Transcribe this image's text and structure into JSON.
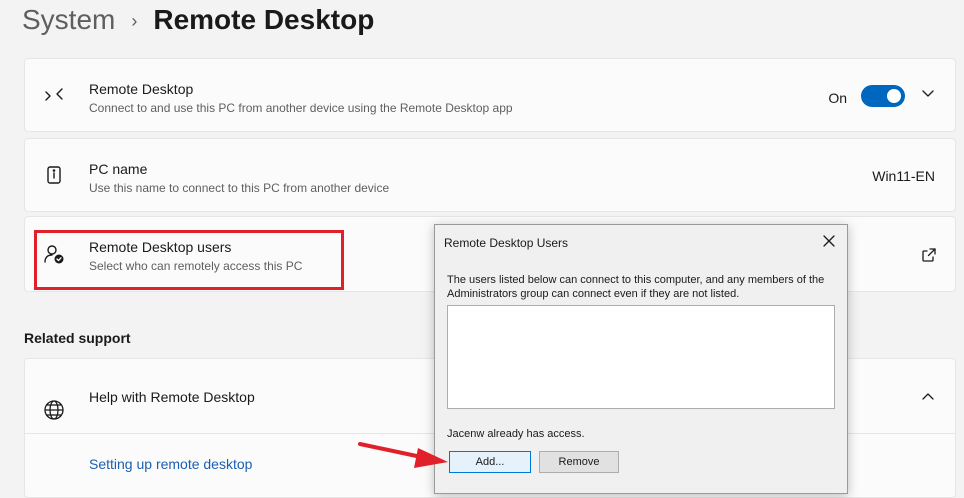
{
  "breadcrumb": {
    "parent": "System",
    "separator": "›",
    "current": "Remote Desktop"
  },
  "remote_desktop": {
    "title": "Remote Desktop",
    "description": "Connect to and use this PC from another device using the Remote Desktop app",
    "toggle_state_label": "On",
    "toggle_on": true
  },
  "pc_name": {
    "title": "PC name",
    "description": "Use this name to connect to this PC from another device",
    "value": "Win11-EN"
  },
  "remote_users": {
    "title": "Remote Desktop users",
    "description": "Select who can remotely access this PC"
  },
  "related_support": {
    "label": "Related support",
    "help_title": "Help with Remote Desktop",
    "link": "Setting up remote desktop"
  },
  "dialog": {
    "title": "Remote Desktop Users",
    "info_text": "The users listed below can connect to this computer, and any members of the Administrators group can connect even if they are not listed.",
    "users": [],
    "status": "Jacenw already has access.",
    "add_label": "Add...",
    "remove_label": "Remove"
  },
  "colors": {
    "accent": "#0067c0",
    "highlight": "#e0212b",
    "link": "#1a5fb4"
  }
}
